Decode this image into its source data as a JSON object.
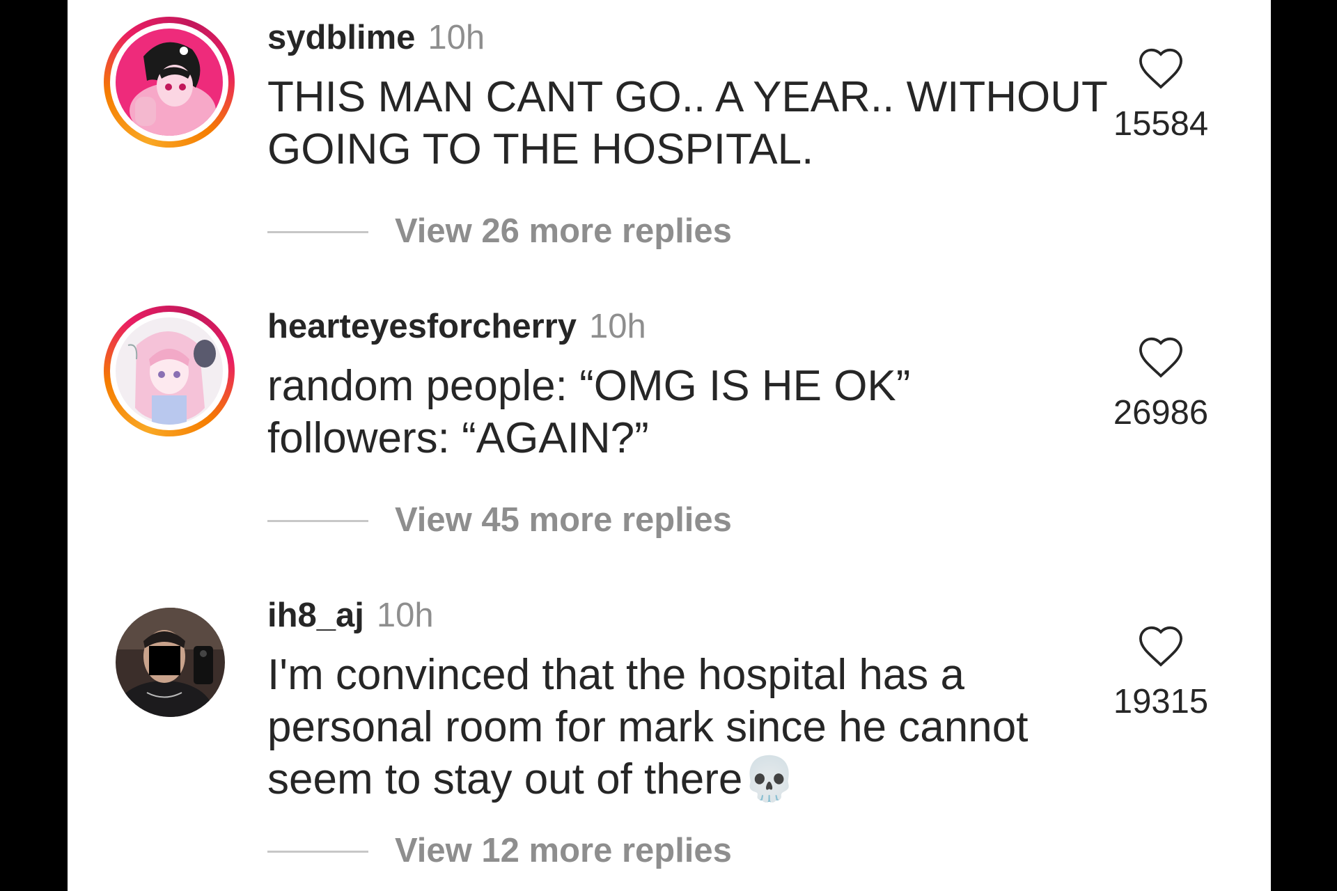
{
  "comments": [
    {
      "username": "sydblime",
      "time": "10h",
      "text_lines": [
        "THIS MAN CANT GO.. A YEAR.. WITHOUT",
        "GOING TO THE HOSPITAL."
      ],
      "likes": "15584",
      "replies_label": "View 26 more replies",
      "avatar": "anime-character-avatar"
    },
    {
      "username": "hearteyesforcherry",
      "time": "10h",
      "text_lines": [
        "random people: “OMG IS HE OK”",
        "followers: “AGAIN?”"
      ],
      "likes": "26986",
      "replies_label": "View 45 more replies",
      "avatar": "anime-character-avatar"
    },
    {
      "username": "ih8_aj",
      "time": "10h",
      "text_lines": [
        "I'm convinced that the hospital has a",
        "personal room for mark since he cannot",
        "seem to stay out of there"
      ],
      "text_emoji": "💀",
      "likes": "19315",
      "replies_label": "View 12 more replies",
      "avatar": "mirror-selfie-avatar"
    }
  ],
  "icons": {
    "like": "heart-outline-icon",
    "emoji": "skull-emoji"
  },
  "colors": {
    "text": "#262626",
    "secondary": "#8e8e8e",
    "ring_start": "#f9a825",
    "ring_end": "#e91e63"
  }
}
